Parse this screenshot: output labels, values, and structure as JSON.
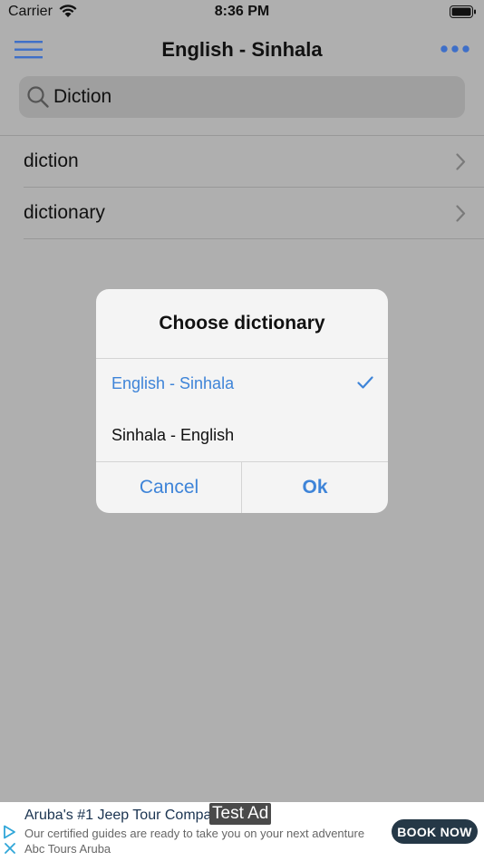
{
  "status_bar": {
    "carrier": "Carrier",
    "time": "8:36 PM"
  },
  "nav": {
    "title": "English - Sinhala"
  },
  "search": {
    "value": "Diction"
  },
  "results": [
    {
      "label": "diction"
    },
    {
      "label": "dictionary"
    }
  ],
  "dialog": {
    "title": "Choose dictionary",
    "options": [
      {
        "label": "English - Sinhala",
        "selected": true
      },
      {
        "label": "Sinhala - English",
        "selected": false
      }
    ],
    "cancel_label": "Cancel",
    "ok_label": "Ok"
  },
  "ad": {
    "title": "Aruba's #1 Jeep Tour Company",
    "body": "Our certified guides are ready to take you on your next adventure Abc Tours Aruba",
    "test_label": "Test Ad",
    "cta_label": "BOOK NOW"
  },
  "colors": {
    "accent": "#3e84d8",
    "dimmed_background": "#afafaf",
    "cta_background": "#253847"
  },
  "icons": {
    "menu": "hamburger-icon",
    "more": "more-icon",
    "search": "search-icon",
    "row_chevron": "chevron-right-icon",
    "selection": "check-icon"
  }
}
